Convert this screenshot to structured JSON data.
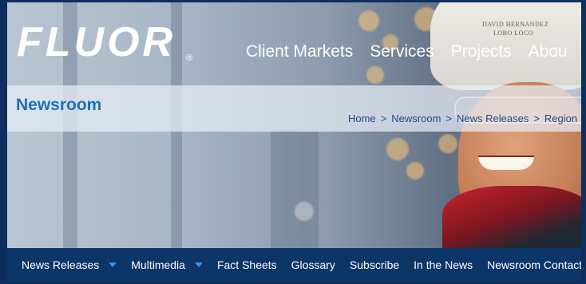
{
  "brand": {
    "logo_text": "FLUOR",
    "registered_mark": "®"
  },
  "main_nav": [
    "Client Markets",
    "Services",
    "Projects",
    "Abou"
  ],
  "hero": {
    "hat_text_line1": "DAVID HERNANDEZ",
    "hat_text_line2": "LOBO LOCO"
  },
  "page": {
    "title": "Newsroom"
  },
  "breadcrumb": [
    "Home",
    "Newsroom",
    "News Releases",
    "Region"
  ],
  "breadcrumb_separator": ">",
  "subnav": [
    {
      "label": "News Releases",
      "dropdown": true
    },
    {
      "label": "Multimedia",
      "dropdown": true
    },
    {
      "label": "Fact Sheets",
      "dropdown": false
    },
    {
      "label": "Glossary",
      "dropdown": false
    },
    {
      "label": "Subscribe",
      "dropdown": false
    },
    {
      "label": "In the News",
      "dropdown": false
    },
    {
      "label": "Newsroom Contacts",
      "dropdown": false
    }
  ],
  "colors": {
    "nav_bar": "#0c3568",
    "title_blue": "#1f6fb8",
    "caret": "#3d8fe0"
  }
}
